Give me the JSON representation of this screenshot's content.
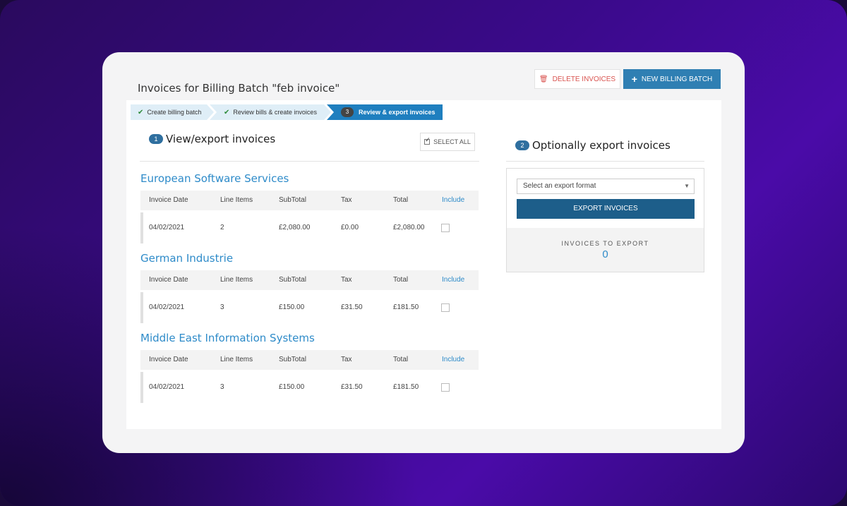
{
  "page": {
    "title": "Invoices for Billing Batch \"feb invoice\"",
    "delete_label": "DELETE INVOICES",
    "new_batch_label": "NEW BILLING BATCH"
  },
  "steps": [
    {
      "label": "Create billing batch",
      "status": "done"
    },
    {
      "label": "Review bills & create invoices",
      "status": "done"
    },
    {
      "number": "3",
      "label": "Review & export invoices",
      "status": "active"
    }
  ],
  "view_section": {
    "number": "1",
    "title": "View/export invoices",
    "select_all_label": "SELECT ALL"
  },
  "table_headers": {
    "invoice_date": "Invoice Date",
    "line_items": "Line Items",
    "subtotal": "SubTotal",
    "tax": "Tax",
    "total": "Total",
    "include": "Include"
  },
  "companies": [
    {
      "name": "European Software Services",
      "invoice_date": "04/02/2021",
      "line_items": "2",
      "subtotal": "£2,080.00",
      "tax": "£0.00",
      "total": "£2,080.00",
      "include": false
    },
    {
      "name": "German Industrie",
      "invoice_date": "04/02/2021",
      "line_items": "3",
      "subtotal": "£150.00",
      "tax": "£31.50",
      "total": "£181.50",
      "include": false
    },
    {
      "name": "Middle East Information Systems",
      "invoice_date": "04/02/2021",
      "line_items": "3",
      "subtotal": "£150.00",
      "tax": "£31.50",
      "total": "£181.50",
      "include": false
    }
  ],
  "export_section": {
    "number": "2",
    "title": "Optionally export invoices",
    "format_placeholder": "Select an export format",
    "export_label": "EXPORT INVOICES",
    "count_label": "INVOICES TO EXPORT",
    "count": "0"
  },
  "colors": {
    "accent": "#2e8bc9",
    "primary_button": "#2f7fb3",
    "export_button": "#1d5e8a",
    "danger": "#d9534f"
  }
}
